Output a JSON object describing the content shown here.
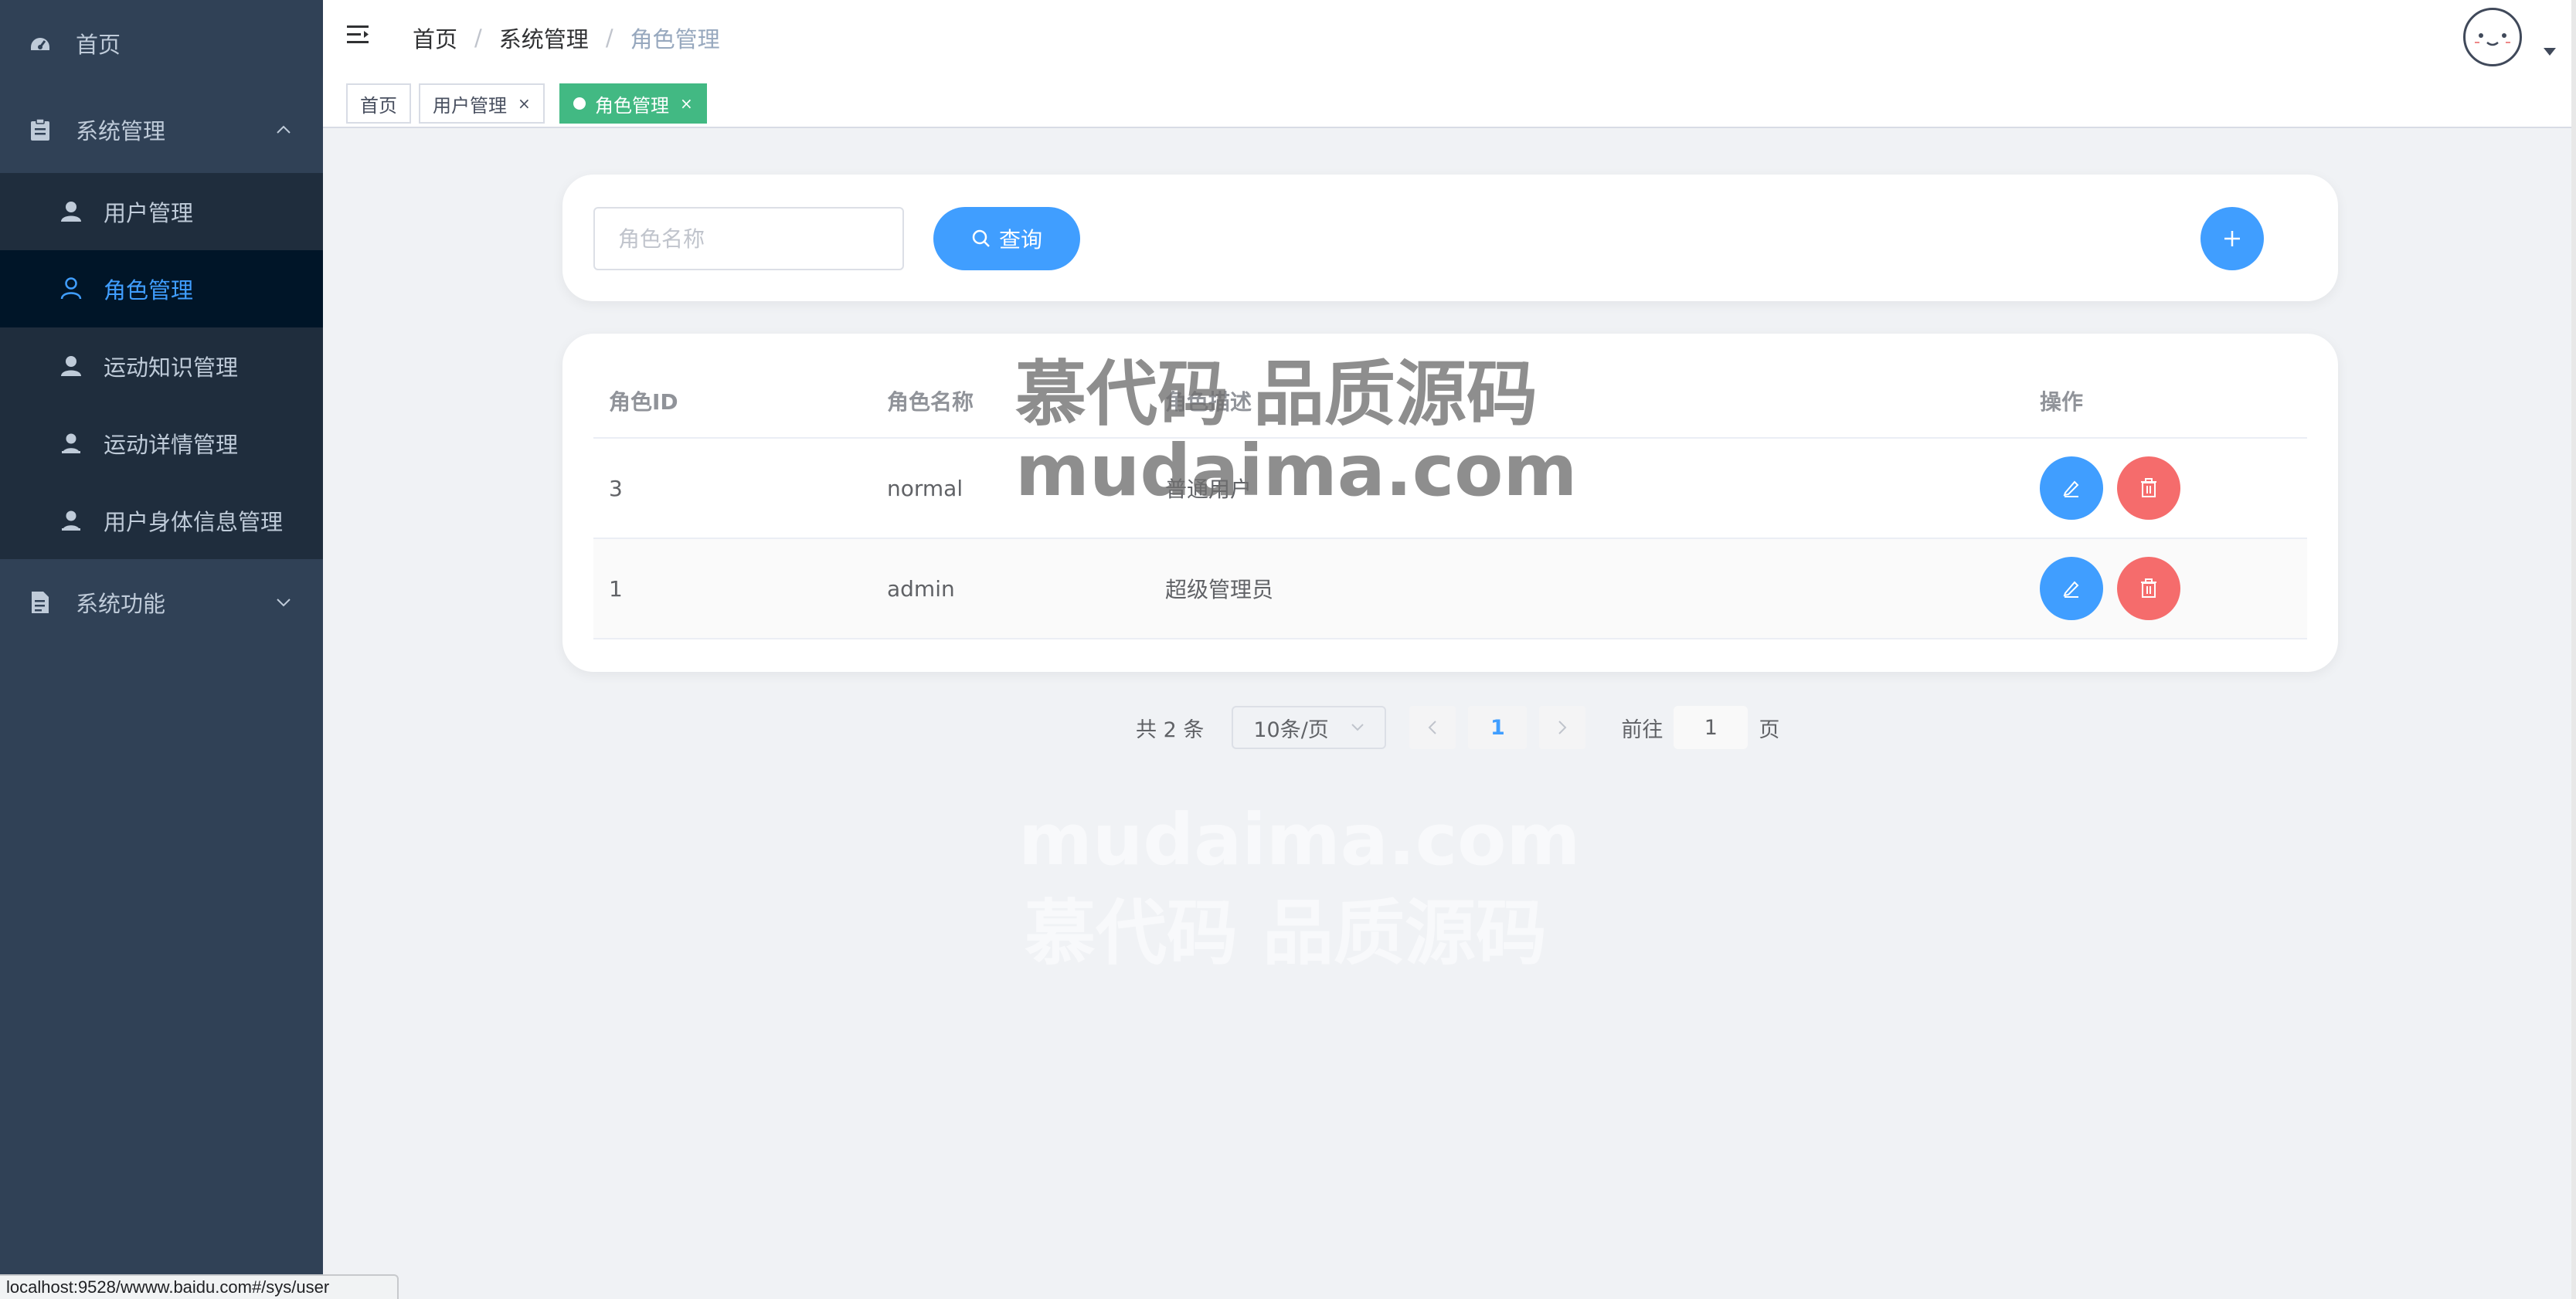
{
  "sidebar": {
    "items": [
      {
        "label": "首页",
        "icon": "dashboard-icon"
      },
      {
        "label": "系统管理",
        "icon": "clipboard-icon",
        "expanded": true,
        "children": [
          {
            "label": "用户管理",
            "icon": "user-icon"
          },
          {
            "label": "角色管理",
            "icon": "user-outline-icon",
            "active": true
          },
          {
            "label": "运动知识管理",
            "icon": "user-icon"
          },
          {
            "label": "运动详情管理",
            "icon": "user-tie-icon"
          },
          {
            "label": "用户身体信息管理",
            "icon": "user-tie-icon"
          }
        ]
      },
      {
        "label": "系统功能",
        "icon": "document-icon",
        "expanded": false
      }
    ]
  },
  "navbar": {
    "breadcrumb": [
      "首页",
      "系统管理",
      "角色管理"
    ],
    "avatar": "avatar"
  },
  "tags": [
    {
      "label": "首页"
    },
    {
      "label": "用户管理",
      "close": "×"
    },
    {
      "label": "角色管理",
      "close": "×",
      "active": true
    }
  ],
  "search": {
    "placeholder": "角色名称",
    "value": "",
    "query_label": "查询"
  },
  "table": {
    "headers": [
      "角色ID",
      "角色名称",
      "角色描述",
      "操作"
    ],
    "rows": [
      {
        "id": "3",
        "name": "normal",
        "desc": "普通用户"
      },
      {
        "id": "1",
        "name": "admin",
        "desc": "超级管理员"
      }
    ]
  },
  "pagination": {
    "total": "共 2 条",
    "page_size": "10条/页",
    "current_page": "1",
    "goto_label": "前往",
    "goto_value": "1",
    "page_suffix": "页"
  },
  "watermark": {
    "line1": "慕代码 品质源码",
    "line2": "mudaima.com"
  },
  "status_bar": "localhost:9528/wwww.baidu.com#/sys/user",
  "colors": {
    "sidebar_bg": "#304156",
    "active": "#409eff",
    "danger": "#f56c6c",
    "tag_active": "#42b983"
  }
}
